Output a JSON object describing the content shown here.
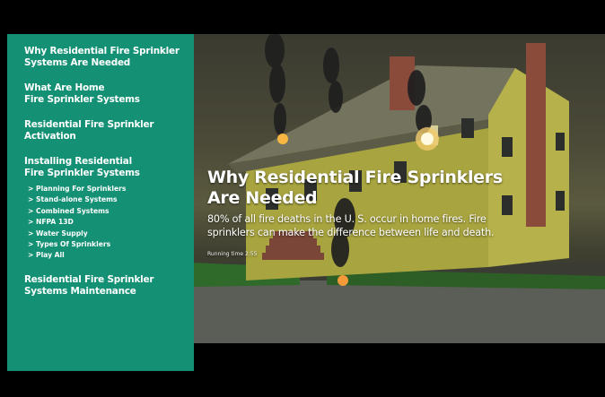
{
  "menu": {
    "items": [
      {
        "label": "Why Residential Fire Sprinkler\nSystems Are Needed"
      },
      {
        "label": "What Are Home\nFire Sprinkler Systems"
      },
      {
        "label": "Residential Fire Sprinkler\nActivation"
      },
      {
        "label": "Installing Residential\nFire Sprinkler Systems"
      },
      {
        "label": "Residential Fire Sprinkler\nSystems Maintenance"
      }
    ],
    "sub_items": [
      {
        "label": "Planning For Sprinklers"
      },
      {
        "label": "Stand-alone Systems"
      },
      {
        "label": "Combined Systems"
      },
      {
        "label": "NFPA 13D"
      },
      {
        "label": "Water Supply"
      },
      {
        "label": "Types Of Sprinklers"
      },
      {
        "label": "Play All"
      }
    ]
  },
  "video": {
    "title": "Why Residential Fire Sprinklers\nAre Needed",
    "description": "80% of all fire deaths in the U. S. occur in home fires. Fire\nsprinklers can make the difference between life and death.",
    "running_time": "Running time 2:55"
  },
  "colors": {
    "sidebar": "#149075",
    "background": "#000000",
    "house": "#b8b34a",
    "roof": "#6b6a55",
    "chimney": "#8c4a3a"
  }
}
